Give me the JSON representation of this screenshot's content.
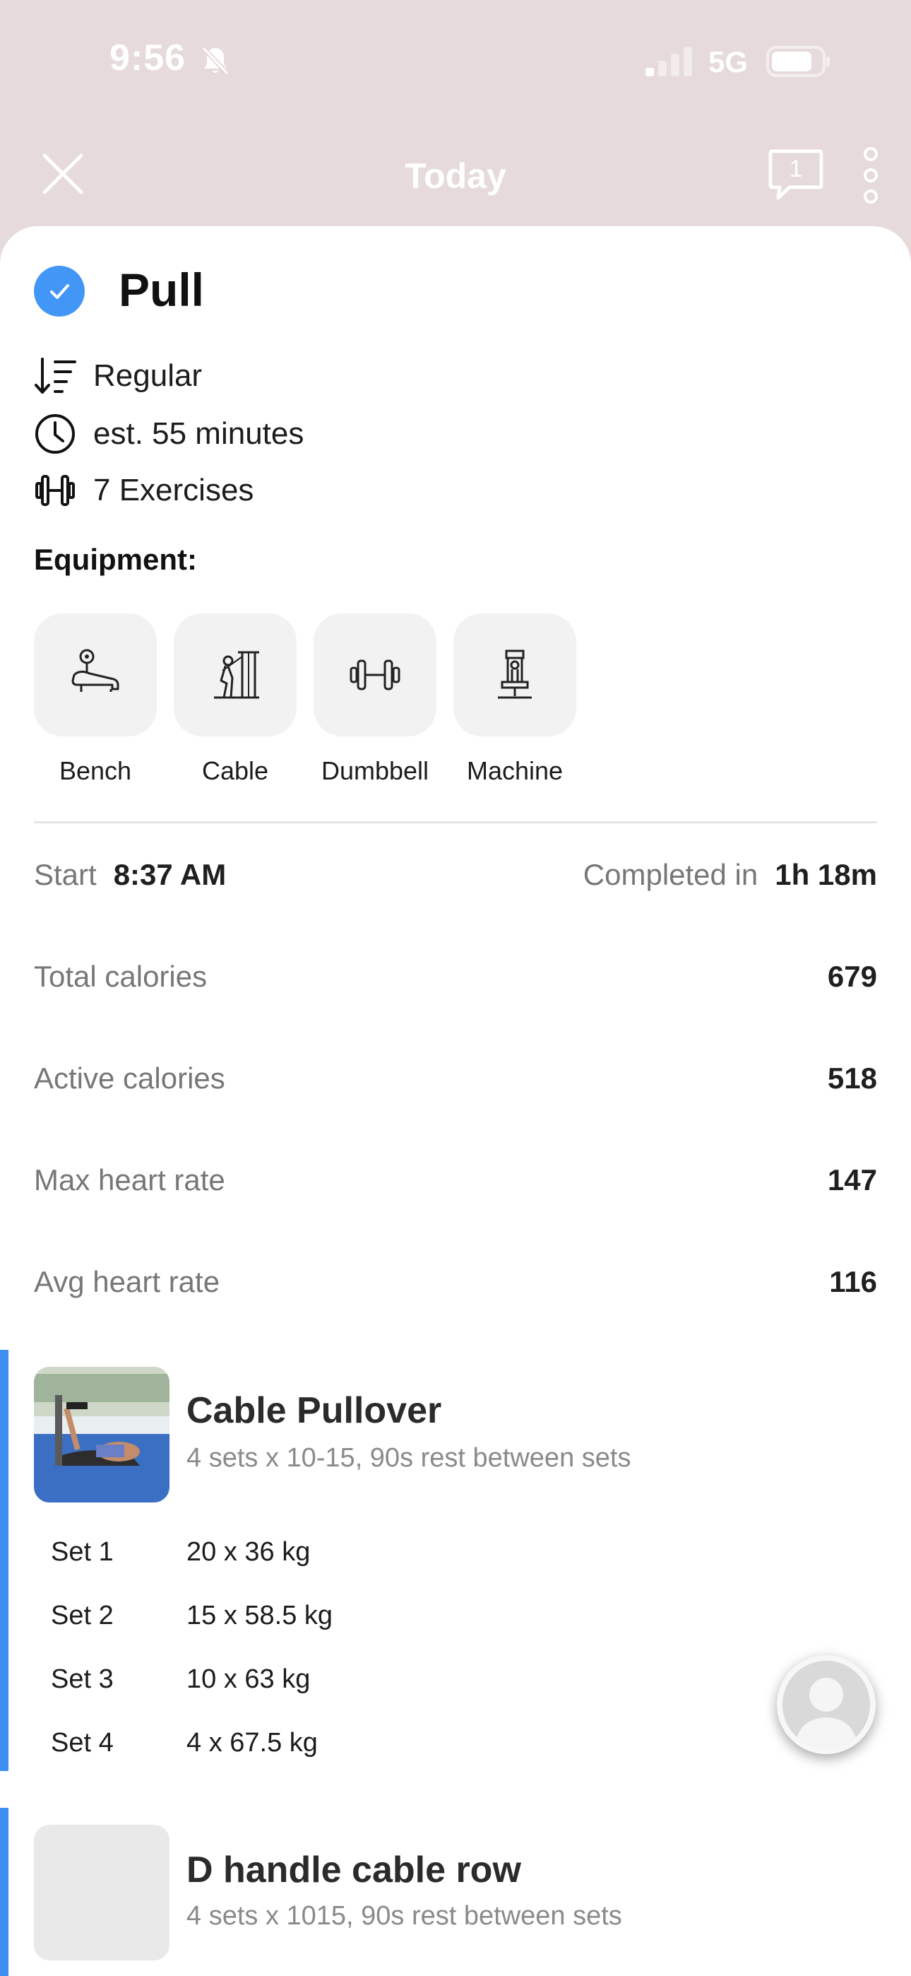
{
  "status_bar": {
    "time": "9:56",
    "network": "5G"
  },
  "nav": {
    "title": "Today",
    "chat_count": "1"
  },
  "workout": {
    "title": "Pull",
    "meta": [
      {
        "icon": "sort-icon",
        "text": "Regular"
      },
      {
        "icon": "clock-icon",
        "text": "est. 55 minutes"
      },
      {
        "icon": "dumbbell-icon",
        "text": "7 Exercises"
      }
    ]
  },
  "equipment": {
    "title": "Equipment:",
    "items": [
      {
        "label": "Bench",
        "icon": "bench-icon"
      },
      {
        "label": "Cable",
        "icon": "cable-icon"
      },
      {
        "label": "Dumbbell",
        "icon": "dumbbell-icon"
      },
      {
        "label": "Machine",
        "icon": "machine-icon"
      }
    ]
  },
  "summary": {
    "start_label": "Start",
    "start_value": "8:37 AM",
    "completed_label": "Completed in",
    "completed_value": "1h 18m",
    "stats": [
      {
        "label": "Total calories",
        "value": "679"
      },
      {
        "label": "Active calories",
        "value": "518"
      },
      {
        "label": "Max heart rate",
        "value": "147"
      },
      {
        "label": "Avg heart rate",
        "value": "116"
      }
    ]
  },
  "exercises": [
    {
      "name": "Cable Pullover",
      "description": "4 sets x 10-15, 90s rest between sets",
      "sets": [
        {
          "label": "Set 1",
          "value": "20 x 36 kg"
        },
        {
          "label": "Set 2",
          "value": "15 x 58.5 kg"
        },
        {
          "label": "Set 3",
          "value": "10 x 63 kg"
        },
        {
          "label": "Set 4",
          "value": "4 x 67.5 kg"
        }
      ]
    },
    {
      "name": "D handle cable row",
      "description": "4 sets x 1015, 90s rest between sets"
    }
  ],
  "colors": {
    "accent": "#4296f6",
    "header_bg": "#e6dadb",
    "tile_bg": "#f2f2f2"
  }
}
